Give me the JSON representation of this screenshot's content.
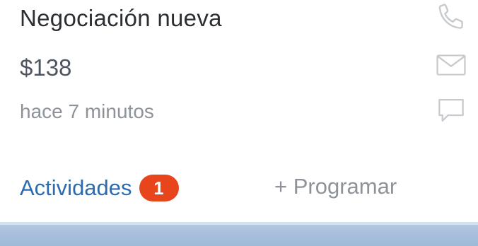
{
  "deal": {
    "title": "Negociación nueva",
    "amount": "$138",
    "time": "hace 7 minutos"
  },
  "icons": {
    "phone": "phone-icon",
    "mail": "mail-icon",
    "chat": "chat-icon"
  },
  "actions": {
    "activities_label": "Actividades",
    "activities_count": "1",
    "schedule_label": "+ Programar"
  },
  "colors": {
    "accent": "#2b6cb0",
    "badge": "#e8451c",
    "muted": "#8e939a",
    "icon": "#c6c9cd",
    "bottom_bar": "#a8c0dc"
  }
}
